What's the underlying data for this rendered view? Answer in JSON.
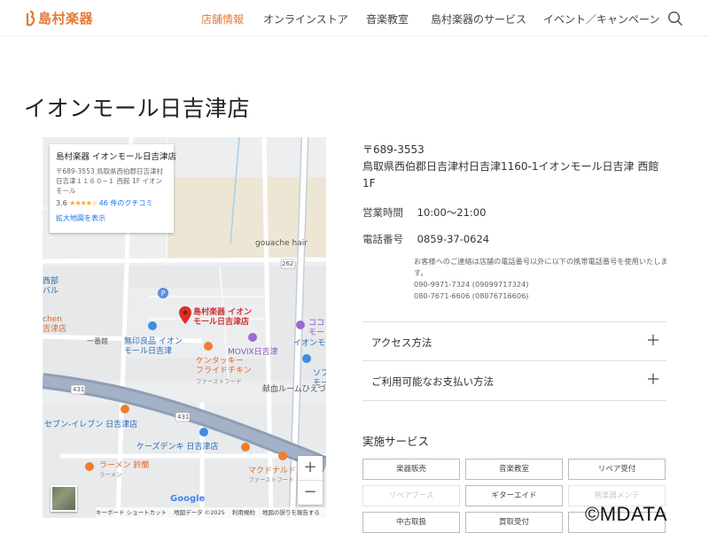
{
  "header": {
    "logo_text": "島村楽器",
    "nav": [
      "店舗情報",
      "オンラインストア",
      "音楽教室",
      "島村楽器のサービス",
      "イベント／キャンペーン"
    ],
    "active_nav": "店舗情報"
  },
  "page_title": "イオンモール日吉津店",
  "map": {
    "info_card": {
      "title": "島村楽器 イオンモール日吉津店",
      "address": "〒689-3553 鳥取県西伯郡日吉津村日吉津１１６０−１ 西館 1F イオンモール",
      "rating": "3.6",
      "stars": "★★★★☆",
      "reviews": "46 件のクチコミ",
      "enlarge": "拡大地図を表示"
    },
    "labels": {
      "gouache": "gouache hair",
      "route262": "262",
      "pin_name": "島村楽器 イオン\nモール日吉津店",
      "muji": "無印良品 イオン\nモール日吉津",
      "movix": "MOVIX日吉津",
      "kfc": "ケンタッキー\nフライドチキン",
      "kfc_sub": "ファーストフード",
      "kenbo": "献血ルームひえづ",
      "ichiban": "一番館",
      "route431a": "431",
      "route431b": "431",
      "seven": "セブン-イレブン 日吉津店",
      "ks": "ケーズデンキ 日吉津店",
      "ramen": "ラーメン 鈴蘭",
      "ramen_sub": "ラーメン",
      "mac": "マクドナルド",
      "mac_sub": "ファーストフード",
      "nishi": "西部\nバル",
      "kitchen": "chen\n吉津店",
      "coco": "ココ\nモー",
      "aeonmo": "イオンモ",
      "sofu": "ソフ\nモー",
      "google": "Google"
    },
    "zoom_in": "+",
    "zoom_out": "−",
    "footer": [
      "キーボード ショートカット",
      "地図データ ©2025",
      "利用規約",
      "地図の誤りを報告する"
    ]
  },
  "store": {
    "postal": "〒689-3553",
    "address": "鳥取県西伯郡日吉津村日吉津1160-1イオンモール日吉津 西館1F",
    "hours_label": "営業時間",
    "hours": "10:00～21:00",
    "phone_label": "電話番号",
    "phone": "0859-37-0624",
    "notice": "お客様へのご連絡は店舗の電話番号以外に以下の携帯電話番号を使用いたします。",
    "mobile1": "090-9971-7324 (09099717324)",
    "mobile2": "080-7671-6606 (08076716606)"
  },
  "accordions": [
    "アクセス方法",
    "ご利用可能なお支払い方法"
  ],
  "services": {
    "title": "実施サービス",
    "items": [
      {
        "label": "楽器販売",
        "enabled": true
      },
      {
        "label": "音楽教室",
        "enabled": true
      },
      {
        "label": "リペア受付",
        "enabled": true
      },
      {
        "label": "リペアブース",
        "enabled": false
      },
      {
        "label": "ギターエイド",
        "enabled": true
      },
      {
        "label": "管楽器メンテ",
        "enabled": false
      },
      {
        "label": "中古取扱",
        "enabled": true
      },
      {
        "label": "買取受付",
        "enabled": true
      },
      {
        "label": "",
        "enabled": true
      }
    ]
  },
  "watermark": "©MDATA",
  "colors": {
    "accent": "#e07b39",
    "link": "#1a73e8",
    "pin": "#d93025"
  }
}
